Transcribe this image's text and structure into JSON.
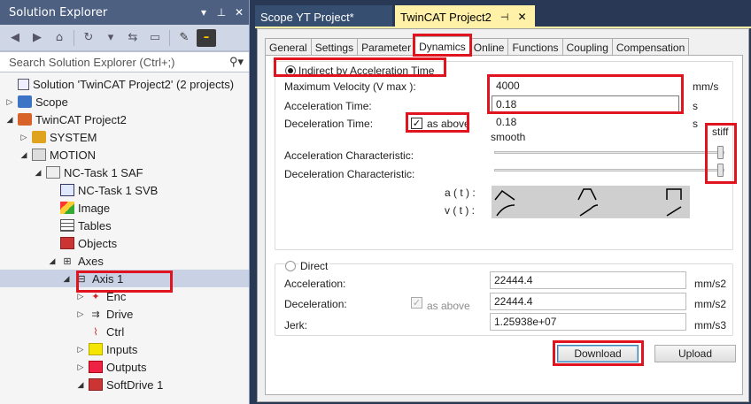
{
  "solution_explorer": {
    "title": "Solution Explorer",
    "title_buttons": {
      "dropdown": "▾",
      "pin": "⊥",
      "close": "✕"
    },
    "search_placeholder": "Search Solution Explorer (Ctrl+;)",
    "tree": [
      {
        "label": "Solution 'TwinCAT Project2' (2 projects)",
        "icon": "solution-icon",
        "expander": ""
      },
      {
        "label": "Scope",
        "icon": "scope-icon",
        "expander": "▷"
      },
      {
        "label": "TwinCAT Project2",
        "icon": "twincat-project-icon",
        "expander": "◢"
      },
      {
        "label": "SYSTEM",
        "icon": "system-icon",
        "expander": "▷"
      },
      {
        "label": "MOTION",
        "icon": "motion-icon",
        "expander": "◢"
      },
      {
        "label": "NC-Task 1 SAF",
        "icon": "nc-task-icon",
        "expander": "◢"
      },
      {
        "label": "NC-Task 1 SVB",
        "icon": "nc-svb-icon",
        "expander": ""
      },
      {
        "label": "Image",
        "icon": "image-icon",
        "expander": ""
      },
      {
        "label": "Tables",
        "icon": "tables-icon",
        "expander": ""
      },
      {
        "label": "Objects",
        "icon": "objects-icon",
        "expander": ""
      },
      {
        "label": "Axes",
        "icon": "axes-icon",
        "expander": "◢"
      },
      {
        "label": "Axis 1",
        "icon": "axis-icon",
        "expander": "◢"
      },
      {
        "label": "Enc",
        "icon": "encoder-icon",
        "expander": "▷"
      },
      {
        "label": "Drive",
        "icon": "drive-icon",
        "expander": "▷"
      },
      {
        "label": "Ctrl",
        "icon": "controller-icon",
        "expander": ""
      },
      {
        "label": "Inputs",
        "icon": "inputs-icon",
        "expander": "▷"
      },
      {
        "label": "Outputs",
        "icon": "outputs-icon",
        "expander": "▷"
      },
      {
        "label": "SoftDrive 1",
        "icon": "softdrive-icon",
        "expander": "◢"
      }
    ]
  },
  "document_tabs": [
    {
      "label": "Scope YT Project*",
      "active": false
    },
    {
      "label": "TwinCAT Project2",
      "active": true
    }
  ],
  "doc_tab_buttons": {
    "pin": "⊣",
    "close": "✕"
  },
  "inner_tabs": [
    "General",
    "Settings",
    "Parameter",
    "Dynamics",
    "Online",
    "Functions",
    "Coupling",
    "Compensation"
  ],
  "active_inner_tab": "Dynamics",
  "indirect": {
    "option_label": "Indirect by Acceleration Time",
    "selected": true,
    "max_velocity_label": "Maximum Velocity (V max ):",
    "max_velocity_value": "4000",
    "max_velocity_unit": "mm/s",
    "accel_time_label": "Acceleration Time:",
    "accel_time_value": "0.18",
    "accel_time_unit": "s",
    "decel_time_label": "Deceleration Time:",
    "as_above_label": "as above",
    "as_above_checked": true,
    "decel_time_value": "0.18",
    "decel_time_unit": "s",
    "smooth_label": "smooth",
    "stiff_label": "stiff",
    "accel_char_label": "Acceleration Characteristic:",
    "decel_char_label": "Deceleration Characteristic:",
    "accel_char_level": 1.0,
    "decel_char_level": 1.0,
    "at_label": "a ( t ) :",
    "vt_label": "v ( t ) :"
  },
  "direct": {
    "option_label": "Direct",
    "selected": false,
    "acceleration_label": "Acceleration:",
    "acceleration_value": "22444.4",
    "acceleration_unit": "mm/s2",
    "deceleration_label": "Deceleration:",
    "as_above_label": "as above",
    "deceleration_value": "22444.4",
    "deceleration_unit": "mm/s2",
    "jerk_label": "Jerk:",
    "jerk_value": "1.25938e+07",
    "jerk_unit": "mm/s3"
  },
  "buttons": {
    "download": "Download",
    "upload": "Upload"
  },
  "colors": {
    "highlight": "#e0141e",
    "titlebar": "#4d6082",
    "active_doc_tab": "#fff1a8",
    "ide_background": "#293955"
  }
}
